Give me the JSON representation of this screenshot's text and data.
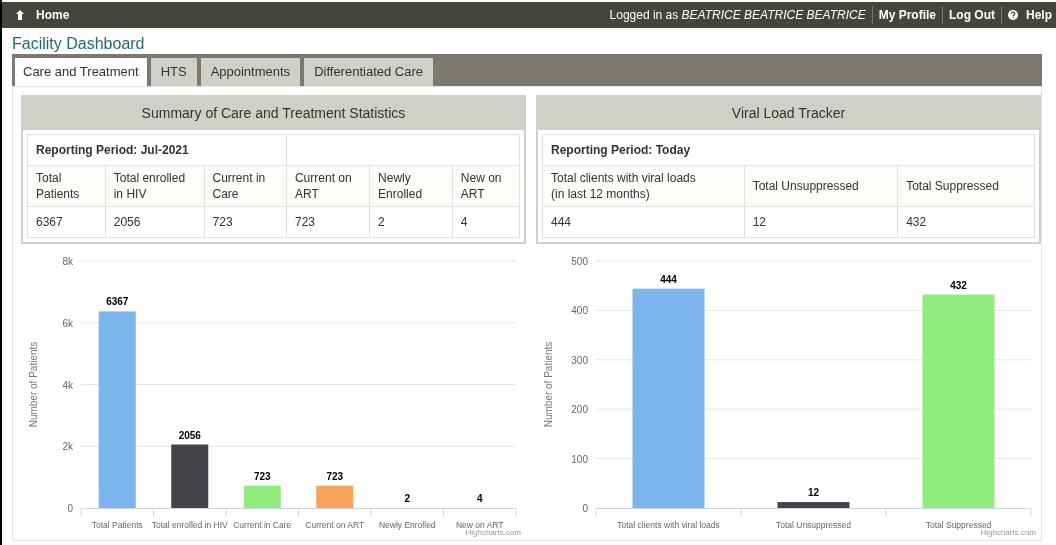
{
  "topbar": {
    "home": "Home",
    "logged_in_prefix": "Logged in as",
    "user": "BEATRICE BEATRICE BEATRICE",
    "links": [
      "My Profile",
      "Log Out"
    ],
    "help": "Help"
  },
  "title": "Facility Dashboard",
  "tabs": [
    {
      "label": "Care and Treatment",
      "selected": true
    },
    {
      "label": "HTS",
      "selected": false
    },
    {
      "label": "Appointments",
      "selected": false
    },
    {
      "label": "Differentiated Care",
      "selected": false
    }
  ],
  "panels": [
    {
      "title": "Summary of Care and Treatment Statistics",
      "period": "Reporting Period: Jul-2021",
      "columns": [
        "Total Patients",
        "Total enrolled in HIV",
        "Current in Care",
        "Current on ART",
        "Newly Enrolled",
        "New on ART"
      ],
      "row": [
        "6367",
        "2056",
        "723",
        "723",
        "2",
        "4"
      ],
      "chart_data": {
        "type": "bar",
        "ylabel": "Number of Patients",
        "categories": [
          "Total Patients",
          "Total enrolled in HIV",
          "Current in Care",
          "Current on ART",
          "Newly Enrolled",
          "New on ART"
        ],
        "series": [
          {
            "values": [
              6367,
              2056,
              723,
              723,
              2,
              4
            ]
          }
        ],
        "colors": [
          "#7cb5ec",
          "#434348",
          "#90ed7d",
          "#f7a35c"
        ],
        "grid": true,
        "ylim": [
          0,
          8000
        ],
        "yticks": [
          {
            "value": 0,
            "label": "0"
          },
          {
            "value": 2000,
            "label": "2k"
          },
          {
            "value": 4000,
            "label": "4k"
          },
          {
            "value": 6000,
            "label": "6k"
          },
          {
            "value": 8000,
            "label": "8k"
          }
        ],
        "data_labels": true,
        "annotations": [
          "Highcharts.com"
        ]
      }
    },
    {
      "title": "Viral Load Tracker",
      "period": "Reporting Period: Today",
      "columns": [
        "Total clients with viral loads\n(in last 12 months)",
        "Total Unsuppressed",
        "Total Suppressed"
      ],
      "row": [
        "444",
        "12",
        "432"
      ],
      "chart_data": {
        "type": "bar",
        "ylabel": "Number of Patients",
        "categories": [
          "Total clients with viral loads",
          "Total Unsuppressed",
          "Total Suppressed"
        ],
        "series": [
          {
            "values": [
              444,
              12,
              432
            ]
          }
        ],
        "grid": true,
        "colors": [
          "#7cb5ec",
          "#434348",
          "#90ed7d"
        ],
        "ylim": [
          0,
          500
        ],
        "yticks": [
          0,
          100,
          200,
          300,
          400,
          500
        ],
        "data_labels": true,
        "annotations": [
          "Highcharts.com"
        ]
      }
    }
  ]
}
